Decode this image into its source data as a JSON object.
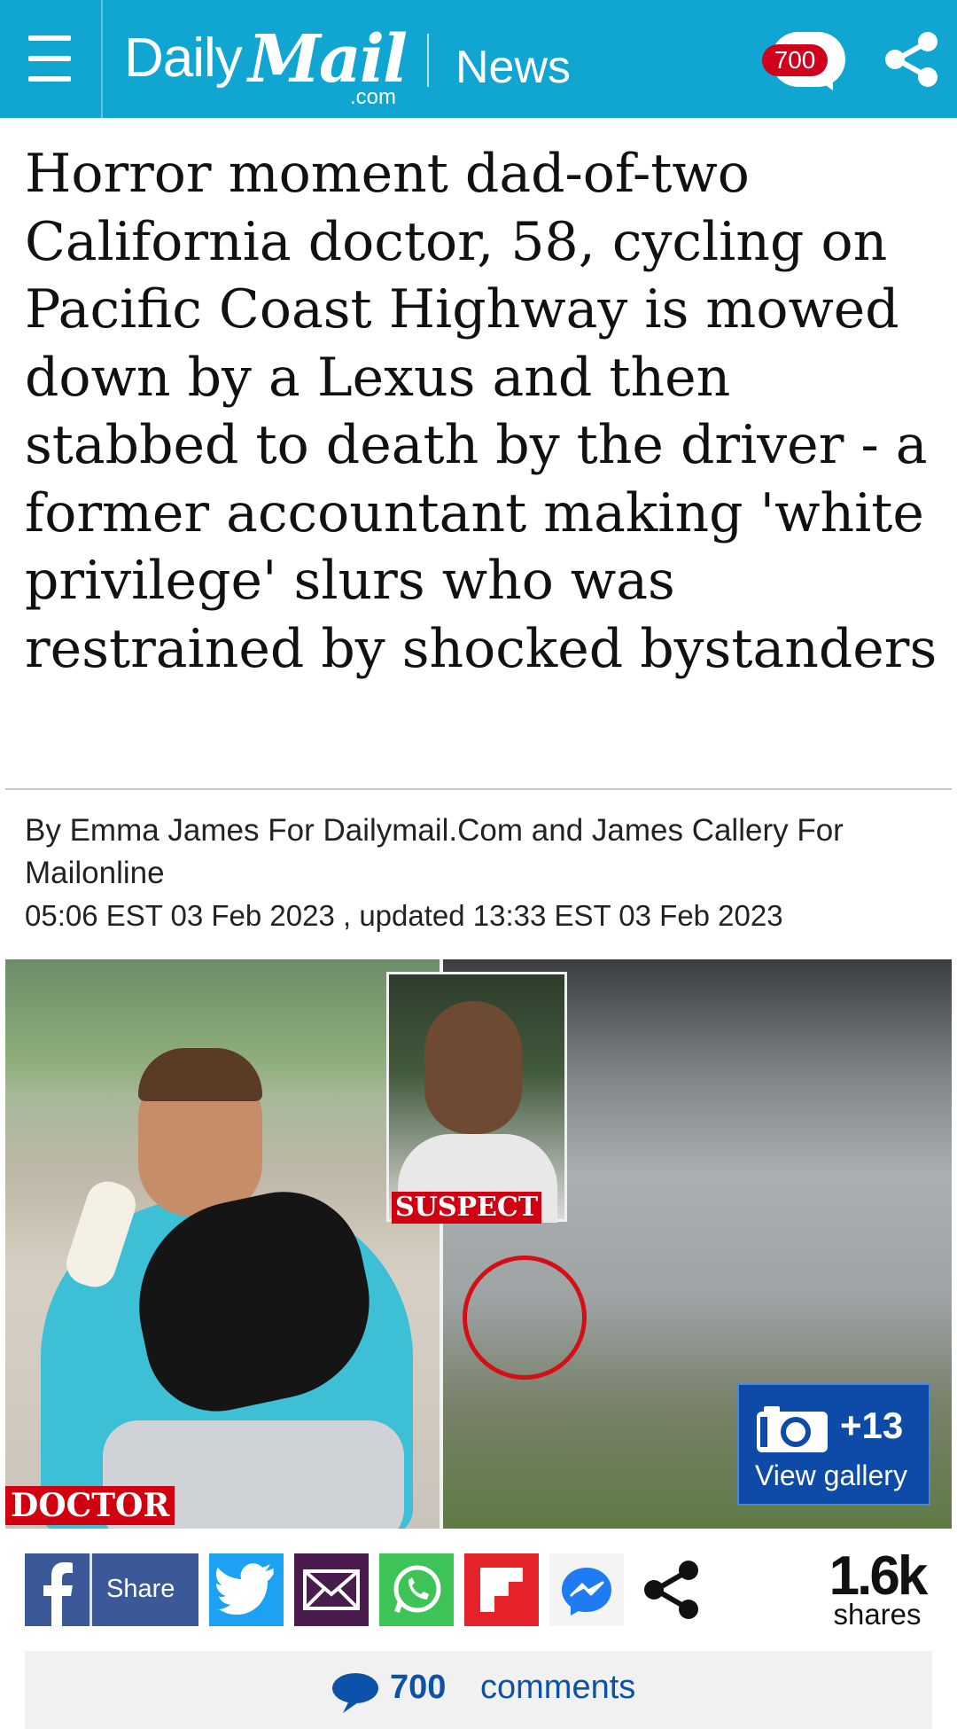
{
  "header": {
    "logo_daily": "Daily",
    "logo_mail": "Mail",
    "logo_dotcom": ".com",
    "section": "News",
    "comment_count": "700",
    "menu_icon": "hamburger-icon",
    "share_icon": "share-icon"
  },
  "article": {
    "headline": "Horror moment dad-of-two California doctor, 58, cycling on Pacific Coast Highway is mowed down by a Lexus and then stabbed to death by the driver - a former accountant making 'white privilege' slurs who was restrained by shocked bystanders",
    "byline": "By Emma James For Dailymail.Com and James Callery For Mailonline",
    "dateline": "05:06 EST 03 Feb 2023 , updated 13:33 EST 03 Feb 2023"
  },
  "hero": {
    "label_suspect": "SUSPECT",
    "label_doctor": "DOCTOR",
    "gallery_count": "+13",
    "gallery_label": "View gallery"
  },
  "share_bar": {
    "facebook_label": "Share",
    "buttons": [
      "facebook-icon",
      "twitter-icon",
      "email-icon",
      "whatsapp-icon",
      "flipboard-icon",
      "messenger-icon",
      "share-icon"
    ],
    "shares_count": "1.6k",
    "shares_label": "shares"
  },
  "comments_bar": {
    "count": "700",
    "label": "comments"
  },
  "colors": {
    "header_bg": "#10a6d1",
    "badge_red": "#d1001c",
    "link_blue": "#0c52a8",
    "gallery_blue": "#0e4aa8"
  }
}
